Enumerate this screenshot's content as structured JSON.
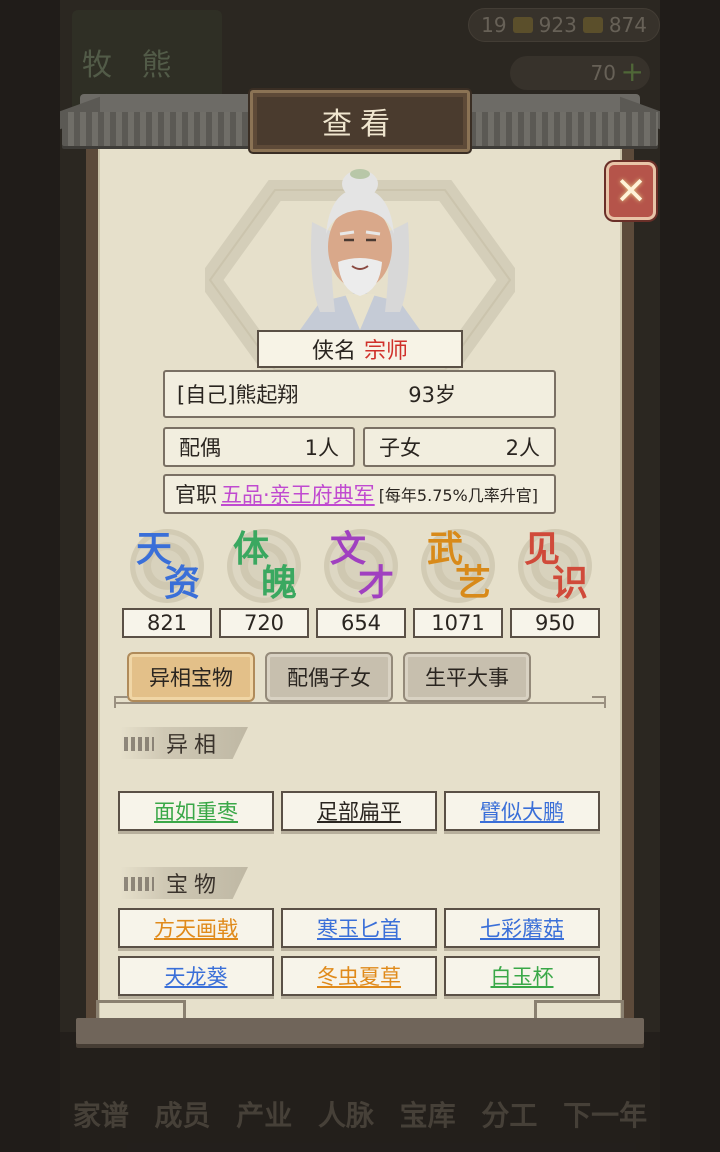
{
  "background": {
    "resources": [
      "19",
      "923",
      "874"
    ],
    "gold": "70",
    "sign_text": "牧 熊 氏",
    "nav": [
      "家谱",
      "成员",
      "产业",
      "人脉",
      "宝库",
      "分工",
      "下一年"
    ]
  },
  "dialog": {
    "title": "查看",
    "close_label": "✕"
  },
  "character": {
    "title_label": "侠名",
    "title_value": "宗师",
    "name": "[自己]熊起翔",
    "age": "93岁",
    "spouse_label": "配偶",
    "spouse_count": "1人",
    "children_label": "子女",
    "children_count": "2人",
    "office_label": "官职",
    "office_value": "五品·亲王府典军",
    "office_note": "[每年5.75%几率升官]"
  },
  "stats": [
    {
      "c1": "天",
      "c2": "资",
      "value": "821",
      "color": "#3a6fd8"
    },
    {
      "c1": "体",
      "c2": "魄",
      "value": "720",
      "color": "#3aa860"
    },
    {
      "c1": "文",
      "c2": "才",
      "value": "654",
      "color": "#a040c0"
    },
    {
      "c1": "武",
      "c2": "艺",
      "value": "1071",
      "color": "#d88a1a"
    },
    {
      "c1": "见",
      "c2": "识",
      "value": "950",
      "color": "#d04a3a"
    }
  ],
  "tabs": [
    "异相宝物",
    "配偶子女",
    "生平大事"
  ],
  "traits": {
    "heading": "异相",
    "items": [
      {
        "label": "面如重枣",
        "color": "#3aa848"
      },
      {
        "label": "足部扁平",
        "color": "#2a2520"
      },
      {
        "label": "臂似大鹏",
        "color": "#3a6fd8"
      }
    ]
  },
  "treasures": {
    "heading": "宝物",
    "items": [
      {
        "label": "方天画戟",
        "color": "#e08a1a"
      },
      {
        "label": "寒玉匕首",
        "color": "#3a6fd8"
      },
      {
        "label": "七彩蘑菇",
        "color": "#3a6fd8"
      },
      {
        "label": "天龙葵",
        "color": "#3a6fd8"
      },
      {
        "label": "冬虫夏草",
        "color": "#e08a1a"
      },
      {
        "label": "白玉杯",
        "color": "#3aa848"
      }
    ]
  }
}
